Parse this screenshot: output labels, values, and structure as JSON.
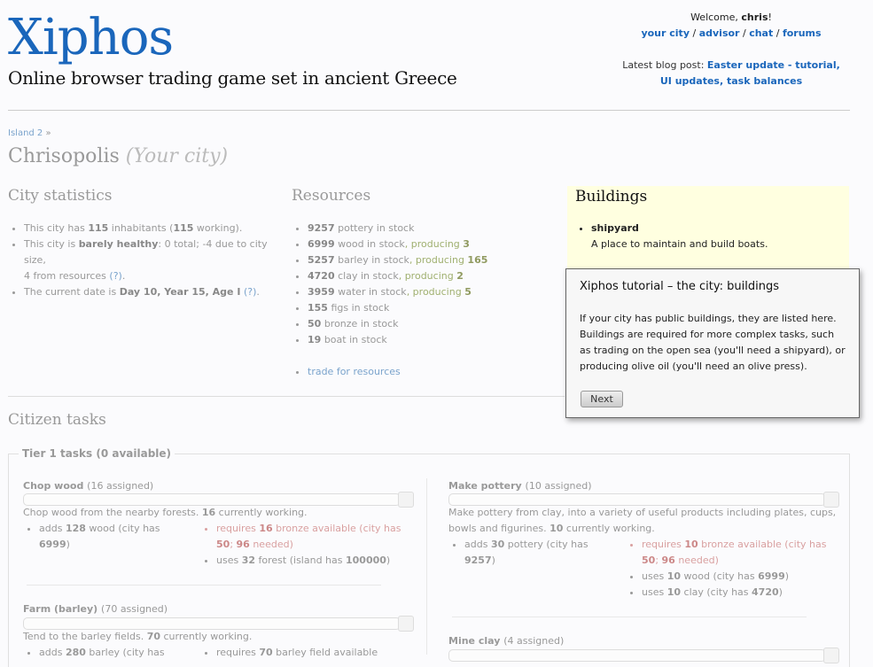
{
  "header": {
    "logo": "Xiphos",
    "tagline": "Online browser trading game set in ancient Greece",
    "welcome_prefix": "Welcome, ",
    "username": "chris",
    "welcome_suffix": "!",
    "nav": [
      "your city",
      "advisor",
      "chat",
      "forums"
    ],
    "blog_prefix": "Latest blog post: ",
    "blog_link_line1": "Easter update - tutorial, UI",
    "blog_link_line2": "updates, task balances"
  },
  "breadcrumb": {
    "island": "Island 2",
    "sep": "»"
  },
  "city": {
    "name": "Chrisopolis",
    "note": "(Your city)"
  },
  "stats": {
    "heading": "City statistics",
    "inhabitants": "115",
    "working": "115",
    "health_label": "barely healthy",
    "health_rest": ": 0 total; -4 due to city size,",
    "health_line2": "4 from resources",
    "help": "(?)",
    "date": "Day 10, Year 15, Age I"
  },
  "resources": {
    "heading": "Resources",
    "items": [
      {
        "n": "9257",
        "label": "pottery in stock",
        "prod": ""
      },
      {
        "n": "6999",
        "label": "wood in stock",
        "prod": "3"
      },
      {
        "n": "5257",
        "label": "barley in stock",
        "prod": "165"
      },
      {
        "n": "4720",
        "label": "clay in stock",
        "prod": "2"
      },
      {
        "n": "3959",
        "label": "water in stock",
        "prod": "5"
      },
      {
        "n": "155",
        "label": "figs in stock",
        "prod": ""
      },
      {
        "n": "50",
        "label": "bronze in stock",
        "prod": ""
      },
      {
        "n": "19",
        "label": "boat in stock",
        "prod": ""
      }
    ],
    "trade": "trade for resources"
  },
  "buildings": {
    "heading": "Buildings",
    "name": "shipyard",
    "desc": "A place to maintain and build boats."
  },
  "tasks": {
    "heading": "Citizen tasks",
    "tier": "Tier 1 tasks (0 available)",
    "chop": {
      "title": "Chop wood",
      "assigned": "(16 assigned)",
      "desc_pre": "Chop wood from the nearby forests. ",
      "desc_n": "16",
      "desc_post": " currently working.",
      "adds": "128",
      "adds_res": "wood",
      "city_has": "6999",
      "req_n": "16",
      "req_res": "bronze available",
      "req_have": "50",
      "req_need": "96",
      "uses_n": "32",
      "uses_res": "forest",
      "island_has": "100000"
    },
    "farm": {
      "title": "Farm (barley)",
      "assigned": "(70 assigned)",
      "desc_pre": "Tend to the barley fields. ",
      "desc_n": "70",
      "desc_post": " currently working.",
      "adds": "280",
      "adds_res": "barley (city has",
      "req_n": "70",
      "req_res": "barley field available"
    },
    "pottery": {
      "title": "Make pottery",
      "assigned": "(10 assigned)",
      "desc1": "Make pottery from clay, into a variety of useful products including plates, cups,",
      "desc2_pre": "bowls and figurines. ",
      "desc_n": "10",
      "desc_post": " currently working.",
      "adds": "30",
      "adds_res": "pottery",
      "city_has": "9257",
      "req_n": "10",
      "req_res": "bronze available",
      "req_have": "50",
      "req_need": "96",
      "uses1_n": "10",
      "uses1_res": "wood",
      "uses1_have": "6999",
      "uses2_n": "10",
      "uses2_res": "clay",
      "uses2_have": "4720"
    },
    "mineclay": {
      "title": "Mine clay",
      "assigned": "(4 assigned)"
    }
  },
  "tutorial": {
    "title": "Xiphos tutorial – the city: buildings",
    "body": "If your city has public buildings, they are listed here. Buildings are required for more complex tasks, such as trading on the open sea (you'll need a shipyard), or producing olive oil (you'll need an olive press).",
    "next": "Next"
  }
}
